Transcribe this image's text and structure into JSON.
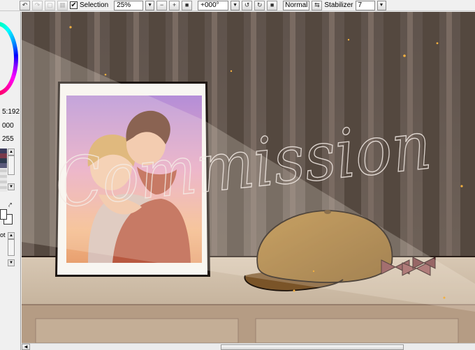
{
  "toolbar": {
    "selection_label": "Selection",
    "selection_checked": "✔",
    "zoom_value": "25%",
    "rotation_value": "+000°",
    "blend_mode": "Normal",
    "stabilizer_label": "Stabilizer",
    "stabilizer_value": "7",
    "icons": [
      "undo-icon",
      "redo-icon",
      "deselect-icon",
      "invert-selection-icon",
      "zoom-out-icon",
      "zoom-in-icon",
      "zoom-reset-icon",
      "rotate-left-icon",
      "rotate-right-icon",
      "rotate-reset-icon",
      "flip-icon"
    ]
  },
  "left_panel": {
    "value_a": "5:192",
    "value_b": "000",
    "value_c": "255",
    "tool_label": "ot",
    "swatches": [
      "#3c3c5c",
      "#7a3a4a",
      "#2e3a4e",
      "#5a5a7a"
    ]
  },
  "canvas": {
    "watermark_text": "Commission",
    "colors": {
      "wall": "#6e6158",
      "stripe_dark": "#5c5049",
      "stripe_light": "#8a7a70",
      "desk": "#c8b8a4",
      "hat": "#a67c3a",
      "frame": "#f8f6f2"
    }
  }
}
